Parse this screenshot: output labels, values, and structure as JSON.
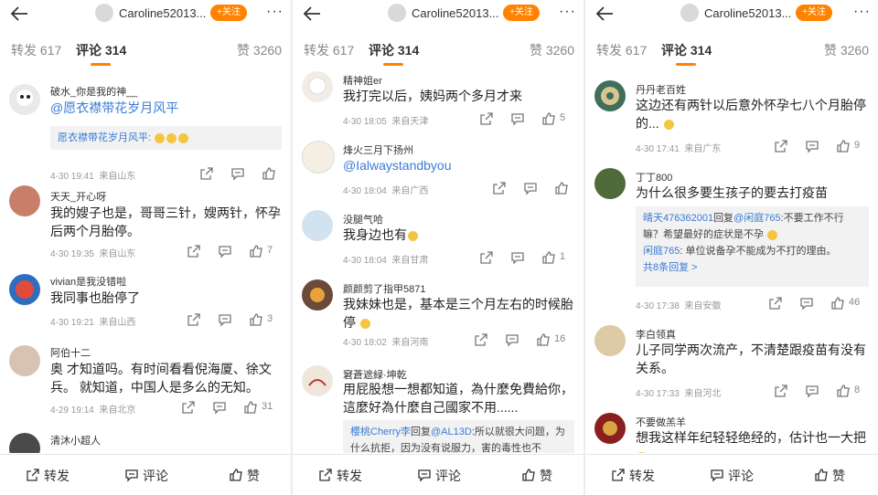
{
  "accent_color": "#ff8200",
  "link_color": "#3a7bd5",
  "header": {
    "user_name": "Caroline52013...",
    "follow_label": "+关注",
    "more": "···"
  },
  "tabs": {
    "reposts": "转发 617",
    "comments": "评论 314",
    "likes": "赞 3260"
  },
  "bottom_bar": {
    "repost": "转发",
    "comment": "评论",
    "like": "赞"
  },
  "panels": [
    {
      "comments": [
        {
          "name": "破水_你是我的神__",
          "text": "@愿衣襟带花岁月风平",
          "reply": "愿衣襟带花岁月风平:",
          "time": "4-30 19:41",
          "location": "来自山东",
          "likes": ""
        },
        {
          "name": "天天_开心呀",
          "text": "我的嫂子也是，哥哥三针，嫂两针，怀孕后两个月胎停。",
          "time": "4-30 19:35",
          "location": "来自山东",
          "likes": "7"
        },
        {
          "name": "vivian是我没错啦",
          "text": "我同事也胎停了",
          "time": "4-30 19:21",
          "location": "来自山西",
          "likes": "3"
        },
        {
          "name": "阿伯十二",
          "text": "奥 才知道吗。有时间看看倪海厦、徐文兵。 就知道，中国人是多么的无知。",
          "time": "4-29 19:14",
          "location": "来自北京",
          "likes": "31"
        },
        {
          "name": "清沐小超人",
          "text": "",
          "time": "",
          "location": "",
          "likes": ""
        }
      ]
    },
    {
      "comments": [
        {
          "name": "精神姐er",
          "text": "我打完以后，姨妈两个多月才来",
          "time": "4-30 18:05",
          "location": "来自天津",
          "likes": "5"
        },
        {
          "name": "烽火三月下扬州",
          "text": "@Ialwaystandbyou",
          "time": "4-30 18:04",
          "location": "来自广西",
          "likes": ""
        },
        {
          "name": "没腿气哈",
          "text": "我身边也有",
          "time": "4-30 18:04",
          "location": "来自甘肃",
          "likes": "1"
        },
        {
          "name": "颜颜剪了指甲5871",
          "text": "我妹妹也是，基本是三个月左右的时候胎停",
          "time": "4-30 18:02",
          "location": "来自河南",
          "likes": "16"
        },
        {
          "name": "窘蒼遮緑·坤乾",
          "text": "用屁股想一想都知道，為什麼免費給你，這麼好為什麼自己國家不用......",
          "reply_user": "樱桃Cherry李",
          "reply_verb": "回复",
          "reply_at": "@AL13D",
          "reply": ":所以就很大问题，为什么抗拒，因为没有说服力，害的毒性也不",
          "time": "",
          "location": "",
          "likes": ""
        }
      ]
    },
    {
      "comments": [
        {
          "name": "丹丹老百姓",
          "text": "这边还有两针以后意外怀孕七八个月胎停的...",
          "time": "4-30 17:41",
          "location": "来自广东",
          "likes": "9"
        },
        {
          "name": "丁丁800",
          "text": "为什么很多要生孩子的要去打疫苗",
          "reply_user": "晴天476362001",
          "reply_verb": "回复",
          "reply_at": "@闲庭765",
          "reply": ":不要工作不行嘛？希望最好的症状是不孕",
          "reply2_user": "闲庭765",
          "reply2": ": 单位说备孕不能成为不打的理由。",
          "reply_more": "共8条回复 >",
          "time": "4-30 17:38",
          "location": "来自安徽",
          "likes": "46"
        },
        {
          "name": "李白领真",
          "text": "儿子同学两次流产，不清楚跟疫苗有没有关系。",
          "time": "4-30 17:33",
          "location": "来自河北",
          "likes": "8"
        },
        {
          "name": "不要做羔羊",
          "text": "想我这样年纪轻轻绝经的，估计也一大把",
          "time": "",
          "location": "",
          "likes": ""
        }
      ]
    }
  ]
}
